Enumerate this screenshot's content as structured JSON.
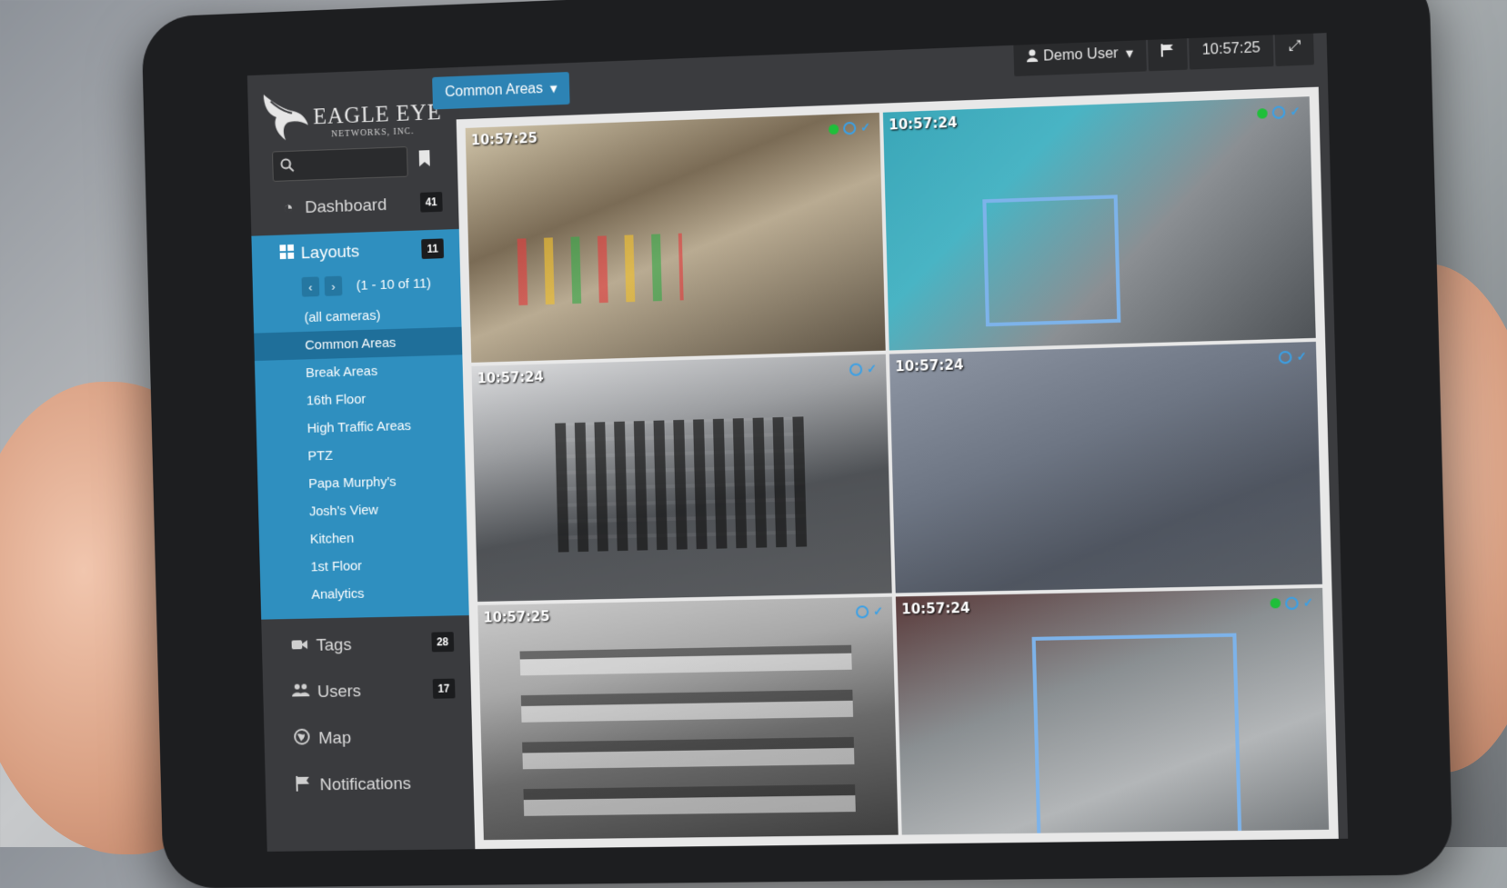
{
  "app": {
    "logo_title": "EAGLE EYE",
    "logo_subtitle": "NETWORKS, INC."
  },
  "search": {
    "placeholder": ""
  },
  "sidebar": {
    "dashboard": {
      "label": "Dashboard",
      "count": "41",
      "icon": "dashboard-icon"
    },
    "layouts": {
      "label": "Layouts",
      "count": "11",
      "icon": "grid-icon",
      "pager_text": "(1 - 10 of 11)",
      "items": [
        {
          "label": "(all cameras)"
        },
        {
          "label": "Common Areas",
          "selected": true
        },
        {
          "label": "Break Areas"
        },
        {
          "label": "16th Floor"
        },
        {
          "label": "High Traffic Areas"
        },
        {
          "label": "PTZ"
        },
        {
          "label": "Papa Murphy's"
        },
        {
          "label": "Josh's View"
        },
        {
          "label": "Kitchen"
        },
        {
          "label": "1st Floor"
        },
        {
          "label": "Analytics"
        }
      ]
    },
    "tags": {
      "label": "Tags",
      "count": "28",
      "icon": "camera-icon"
    },
    "users": {
      "label": "Users",
      "count": "17",
      "icon": "users-icon"
    },
    "map": {
      "label": "Map",
      "icon": "globe-icon"
    },
    "notifications": {
      "label": "Notifications",
      "icon": "flag-icon"
    }
  },
  "topbar": {
    "layout_dropdown": "Common Areas",
    "user_menu": "Demo User",
    "clock": "10:57:25"
  },
  "cameras": [
    {
      "timestamp": "10:57:25",
      "online": true
    },
    {
      "timestamp": "10:57:24",
      "online": true
    },
    {
      "timestamp": "10:57:24",
      "online": false
    },
    {
      "timestamp": "10:57:24",
      "online": false
    },
    {
      "timestamp": "10:57:25",
      "online": false
    },
    {
      "timestamp": "10:57:24",
      "online": true
    }
  ],
  "colors": {
    "accent": "#2f8fbf",
    "selected": "#1f6f9a",
    "sidebar_bg": "#3a3b3e",
    "online": "#1fbf3a",
    "detection_box": "#7db3ea"
  }
}
